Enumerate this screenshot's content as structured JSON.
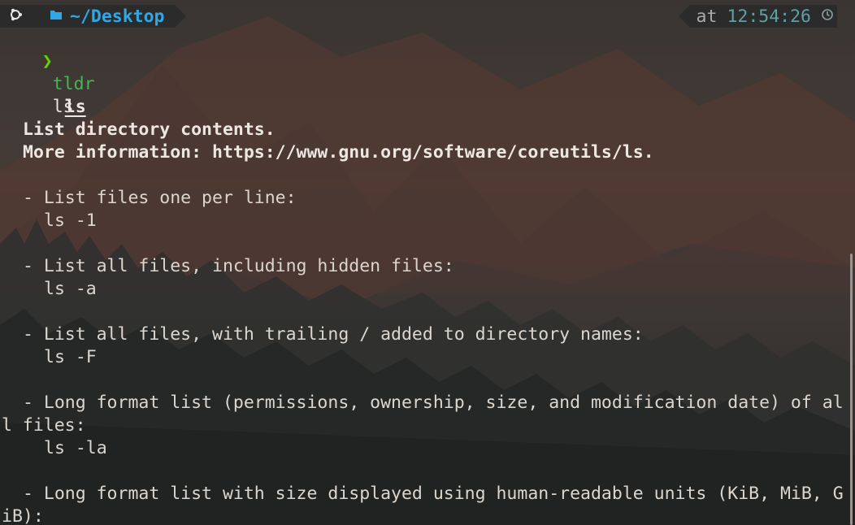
{
  "prompt": {
    "os_icon": "ubuntu-icon",
    "folder_icon": "folder-icon",
    "path": "~/Desktop",
    "time_prefix": "at",
    "time": "12:54:26",
    "clock_icon": "clock-icon",
    "prompt_char": "❯",
    "command": "tldr",
    "argument": "ls"
  },
  "page": {
    "title": "ls",
    "description": "List directory contents.",
    "more_info": "More information: https://www.gnu.org/software/coreutils/ls.",
    "examples": [
      {
        "desc": "- List files one per line:",
        "cmd": "ls -1"
      },
      {
        "desc": "- List all files, including hidden files:",
        "cmd": "ls -a"
      },
      {
        "desc": "- List all files, with trailing / added to directory names:",
        "cmd": "ls -F"
      },
      {
        "desc_line1": "- Long format list (permissions, ownership, size, and modification date) of al",
        "desc_line2": "l files:",
        "cmd": "ls -la"
      },
      {
        "desc_line1": "- Long format list with size displayed using human-readable units (KiB, MiB, G",
        "desc_line2": "iB):"
      }
    ]
  },
  "colors": {
    "prompt_green": "#5fd700",
    "path_blue": "#2fa8e8",
    "command_green": "#3fb950",
    "time_teal": "#5fa0a4"
  }
}
